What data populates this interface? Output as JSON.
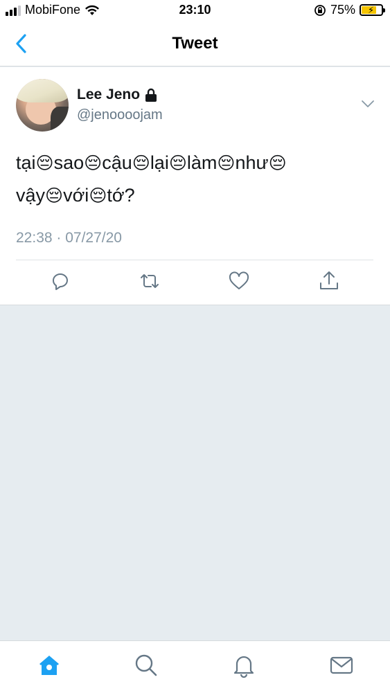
{
  "status_bar": {
    "carrier": "MobiFone",
    "time": "23:10",
    "battery_percent": "75%",
    "battery_level": 0.75
  },
  "nav": {
    "title": "Tweet"
  },
  "tweet": {
    "display_name": "Lee Jeno",
    "handle": "@jenoooojam",
    "text_parts": [
      "tại",
      "sao",
      "cậu",
      "lại",
      "làm",
      "như",
      "vậy",
      "với",
      "tớ?"
    ],
    "emoji": "😔",
    "timestamp": "22:38 · 07/27/20"
  },
  "icons": {
    "back": "chevron-left-icon",
    "lock": "lock-icon",
    "caret": "chevron-down-icon",
    "reply": "reply-icon",
    "retweet": "retweet-icon",
    "like": "heart-icon",
    "share": "share-icon",
    "home": "home-icon",
    "search": "search-icon",
    "notifications": "bell-icon",
    "messages": "mail-icon"
  },
  "colors": {
    "accent": "#1da1f2",
    "muted": "#657786",
    "background": "#e6ecf0"
  }
}
